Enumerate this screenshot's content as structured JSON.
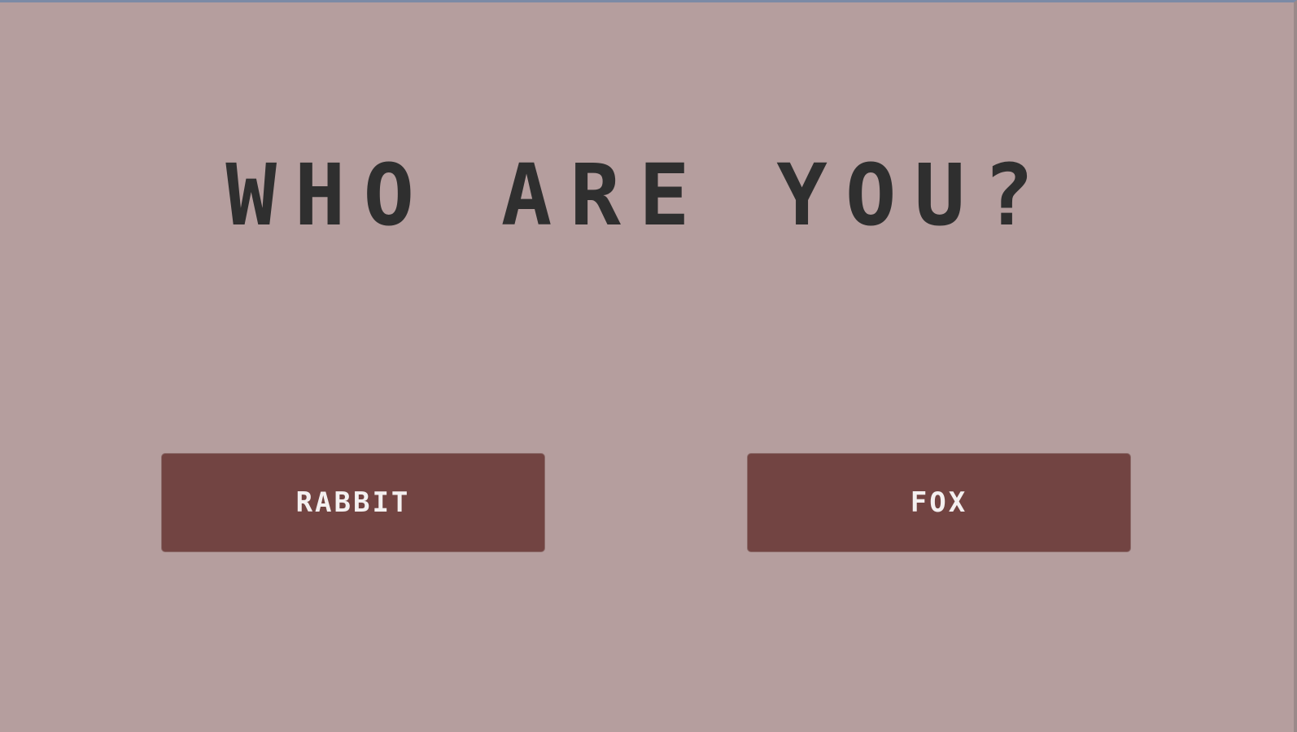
{
  "screen": {
    "title": "WHO ARE YOU?",
    "background_color": "#b59e9e",
    "title_color": "#2f2f2f"
  },
  "choices": [
    {
      "label": "RABBIT",
      "color": "#724442"
    },
    {
      "label": "FOX",
      "color": "#724442"
    }
  ]
}
